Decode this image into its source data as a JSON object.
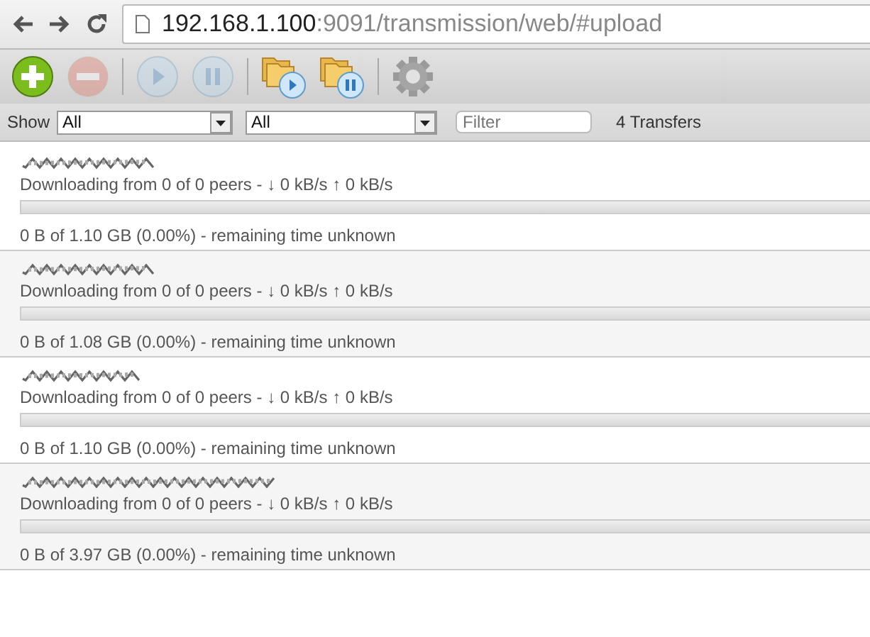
{
  "browser": {
    "url_host": "192.168.1.100",
    "url_rest": ":9091/transmission/web/#upload"
  },
  "toolbar": [
    {
      "kind": "add",
      "disabled": false
    },
    {
      "kind": "remove",
      "disabled": true
    },
    {
      "kind": "sep"
    },
    {
      "kind": "start",
      "disabled": true
    },
    {
      "kind": "pause",
      "disabled": true
    },
    {
      "kind": "sep"
    },
    {
      "kind": "start-all",
      "disabled": false
    },
    {
      "kind": "pause-all",
      "disabled": false
    },
    {
      "kind": "sep"
    },
    {
      "kind": "settings",
      "disabled": false
    }
  ],
  "filter_bar": {
    "show_label": "Show",
    "selects": [
      "All",
      "All"
    ],
    "filter_placeholder": "Filter",
    "count": "4 Transfers"
  },
  "torrents": [
    {
      "peers": "Downloading from 0 of 0 peers - ↓ 0 kB/s ↑ 0 kB/s",
      "level": 0,
      "progress": "0 B of 1.10 GB (0.00%) - remaining time unknown"
    },
    {
      "peers": "Downloading from 0 of 0 peers - ↓ 0 kB/s ↑ 0 kB/s",
      "level": 0,
      "progress": "0 B of 1.08 GB (0.00%) - remaining time unknown"
    },
    {
      "peers": "Downloading from 0 of 0 peers - ↓ 0 kB/s ↑ 0 kB/s",
      "level": 0,
      "progress": "0 B of 1.10 GB (0.00%) - remaining time unknown"
    },
    {
      "peers": "Downloading from 0 of 0 peers - ↓ 0 kB/s ↑ 0 kB/s",
      "level": 0,
      "progress": "0 B of 3.97 GB (0.00%) - remaining time unknown"
    }
  ]
}
